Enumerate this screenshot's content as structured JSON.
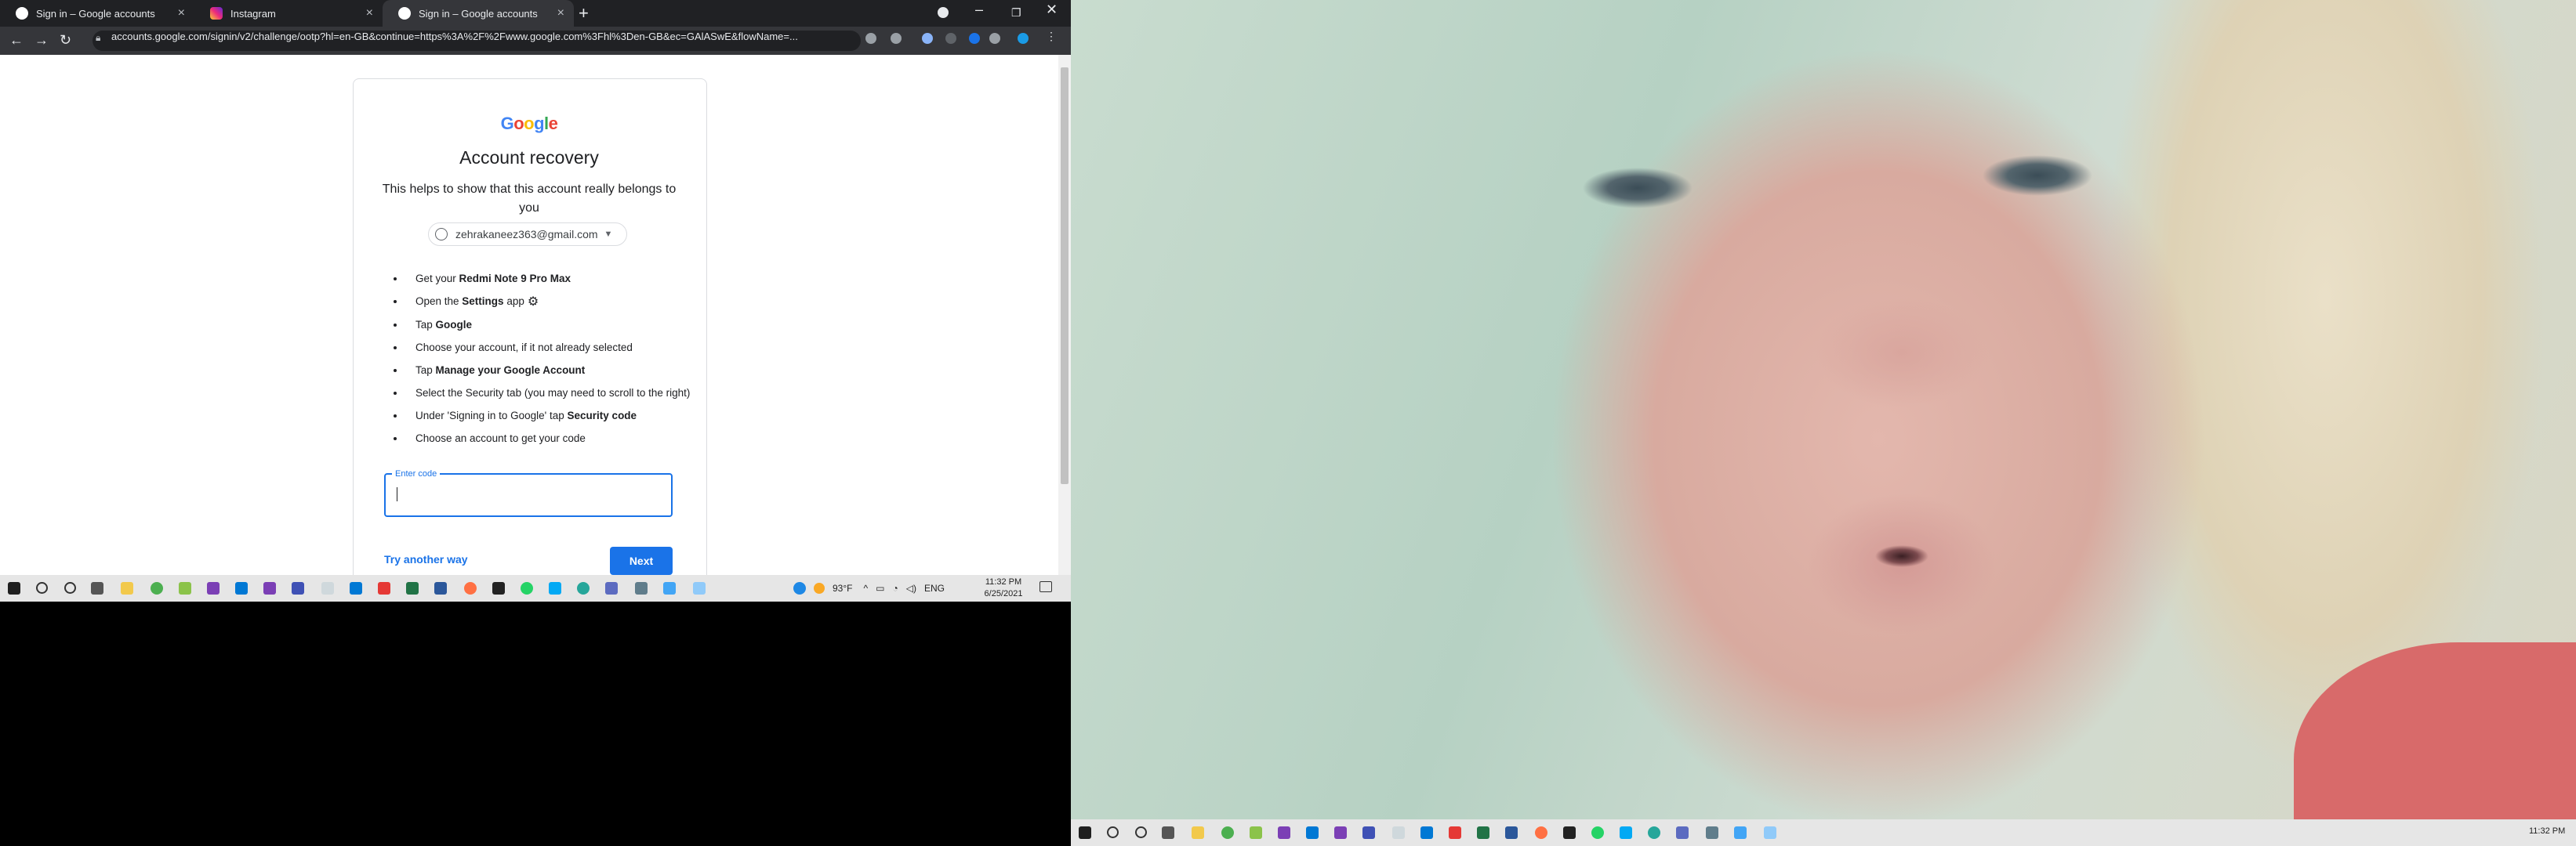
{
  "browser": {
    "tabs": [
      {
        "title": "Sign in – Google accounts",
        "favicon": "google-icon"
      },
      {
        "title": "Instagram",
        "favicon": "instagram-icon"
      },
      {
        "title": "Sign in – Google accounts",
        "favicon": "google-icon",
        "active": true
      }
    ],
    "new_tab_label": "+",
    "url": "accounts.google.com/signin/v2/challenge/ootp?hl=en-GB&continue=https%3A%2F%2Fwww.google.com%3Fhl%3Den-GB&ec=GAlASwE&flowName=..."
  },
  "page": {
    "logo_text": "Google",
    "logo_colors": [
      "#4285F4",
      "#EA4335",
      "#FBBC05",
      "#4285F4",
      "#34A853",
      "#EA4335"
    ],
    "heading": "Account recovery",
    "subtitle": "This helps to show that this account really belongs to you",
    "account_email": "zehrakaneez363@gmail.com",
    "steps": [
      {
        "pre": "Get your ",
        "bold": "Redmi Note 9 Pro Max",
        "post": ""
      },
      {
        "pre": "Open the ",
        "bold": "Settings",
        "post": " app"
      },
      {
        "pre": "Tap ",
        "bold": "Google",
        "post": ""
      },
      {
        "pre": "Choose your account, if it not already selected",
        "bold": "",
        "post": ""
      },
      {
        "pre": "Tap ",
        "bold": "Manage your Google Account",
        "post": ""
      },
      {
        "pre": "Select the Security tab (you may need to scroll to the right)",
        "bold": "",
        "post": ""
      },
      {
        "pre": "Under 'Signing in to Google' tap ",
        "bold": "Security code",
        "post": ""
      },
      {
        "pre": "Choose an account to get your code",
        "bold": "",
        "post": ""
      }
    ],
    "code_field_label": "Enter code",
    "code_value": "",
    "try_another_label": "Try another way",
    "next_label": "Next",
    "accent_color": "#1a73e8"
  },
  "taskbar_left": {
    "weather": "93°F",
    "language": "ENG",
    "time": "11:32 PM",
    "date": "6/25/2021"
  },
  "taskbar_right": {
    "time": "11:32 PM"
  }
}
